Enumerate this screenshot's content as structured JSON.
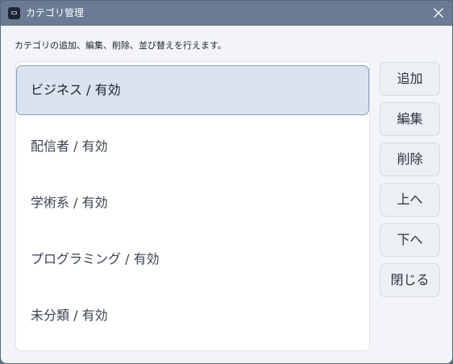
{
  "window": {
    "title": "カテゴリ管理",
    "close_icon": "close-icon",
    "app_icon": "app-icon"
  },
  "description": "カテゴリの追加、編集、削除、並び替えを行えます。",
  "list": {
    "items": [
      {
        "label": "ビジネス / 有効",
        "selected": true
      },
      {
        "label": "配信者 / 有効",
        "selected": false
      },
      {
        "label": "学術系 / 有効",
        "selected": false
      },
      {
        "label": "プログラミング / 有効",
        "selected": false
      },
      {
        "label": "未分類 / 有効",
        "selected": false
      }
    ]
  },
  "buttons": {
    "add": "追加",
    "edit": "編集",
    "delete": "削除",
    "move_up": "上へ",
    "move_down": "下へ",
    "close": "閉じる"
  },
  "colors": {
    "titlebar": "#6a7b93",
    "selection": "#dae4f0",
    "selection_border": "#8b9fba"
  }
}
